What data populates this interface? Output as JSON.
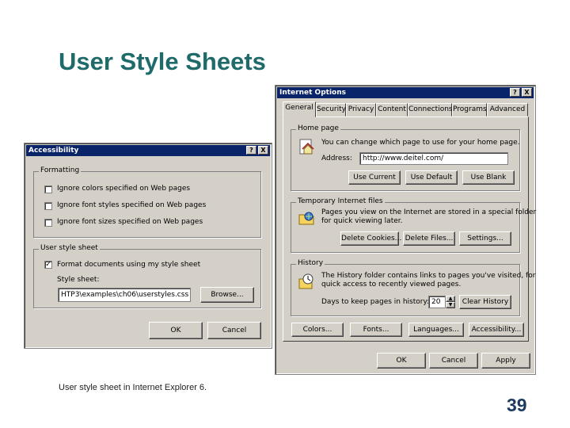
{
  "slide": {
    "title": "User Style Sheets",
    "caption": "User style sheet in Internet Explorer 6.",
    "page_number": "39"
  },
  "accessibility": {
    "title": "Accessibility",
    "help_btn": "?",
    "close_btn": "X",
    "formatting": {
      "label": "Formatting",
      "options": [
        {
          "label": "Ignore colors specified on Web pages",
          "checked": false
        },
        {
          "label": "Ignore font styles specified on Web pages",
          "checked": false
        },
        {
          "label": "Ignore font sizes specified on Web pages",
          "checked": false
        }
      ]
    },
    "user_style_sheet": {
      "label": "User style sheet",
      "format_label": "Format documents using my style sheet",
      "format_checked": true,
      "check_mark": "✓",
      "style_sheet_label": "Style sheet:",
      "style_sheet_value": "HTP3\\examples\\ch06\\userstyles.css",
      "browse": "Browse..."
    },
    "ok": "OK",
    "cancel": "Cancel"
  },
  "internet_options": {
    "title": "Internet Options",
    "help_btn": "?",
    "close_btn": "X",
    "tabs": [
      "General",
      "Security",
      "Privacy",
      "Content",
      "Connections",
      "Programs",
      "Advanced"
    ],
    "home_page": {
      "label": "Home page",
      "desc": "You can change which page to use for your home page.",
      "address_label": "Address:",
      "address_value": "http://www.deitel.com/",
      "use_current": "Use Current",
      "use_default": "Use Default",
      "use_blank": "Use Blank"
    },
    "temp_files": {
      "label": "Temporary Internet files",
      "desc1": "Pages you view on the Internet are stored in a special folder",
      "desc2": "for quick viewing later.",
      "delete_cookies": "Delete Cookies...",
      "delete_files": "Delete Files...",
      "settings": "Settings..."
    },
    "history": {
      "label": "History",
      "desc1": "The History folder contains links to pages you've visited, for",
      "desc2": "quick access to recently viewed pages.",
      "days_label": "Days to keep pages in history:",
      "days_value": "20",
      "clear": "Clear History"
    },
    "bottom_buttons": [
      "Colors...",
      "Fonts...",
      "Languages...",
      "Accessibility..."
    ],
    "ok": "OK",
    "cancel": "Cancel",
    "apply": "Apply"
  }
}
